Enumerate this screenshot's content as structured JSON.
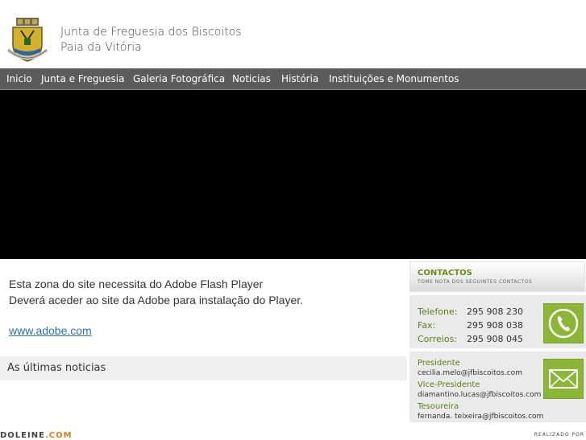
{
  "site": {
    "title_line1": "Junta de Freguesia dos Biscoitos",
    "title_line2": "Paia da Vitória"
  },
  "nav": {
    "items": [
      {
        "label": "Inicio"
      },
      {
        "label": "Junta e Freguesia"
      },
      {
        "label": "Galeria Fotográfica"
      },
      {
        "label": "Noticias"
      },
      {
        "label": "História"
      },
      {
        "label": "Instituições e Monumentos"
      }
    ]
  },
  "flash": {
    "line1": "Esta zona do site necessita do Adobe Flash Player",
    "line2": "Deverá aceder ao site da Adobe para instalação do Player.",
    "link": "www.adobe.com"
  },
  "news": {
    "title": "As últimas noticias"
  },
  "contacts": {
    "title": "CONTACTOS",
    "subtitle": "TOME NOTA DOS SEGUINTES CONTACTOS",
    "phones": [
      {
        "label": "Telefone:",
        "value": "295 908 230"
      },
      {
        "label": "Fax:",
        "value": "295 908 038"
      },
      {
        "label": "Correios:",
        "value": "295 908 045"
      }
    ],
    "people": [
      {
        "role": "Presidente",
        "email": "cecilia.melo@jfbiscoitos.com"
      },
      {
        "role": "Vice-Presidente",
        "email": "diamantino.lucas@jfbiscoitos.com"
      },
      {
        "role": "Tesoureira",
        "email": "fernanda. teixeira@jfbiscoitos.com"
      }
    ],
    "phone_icon": "phone-icon",
    "mail_icon": "envelope-icon"
  },
  "footer": {
    "brand_main": "DOLEINE",
    "brand_accent": ".COM",
    "credit": "REALIZADO POR"
  },
  "colors": {
    "nav_bg": "#5c5c5c",
    "accent_green": "#8cb635",
    "link_blue": "#2a6fb8"
  }
}
